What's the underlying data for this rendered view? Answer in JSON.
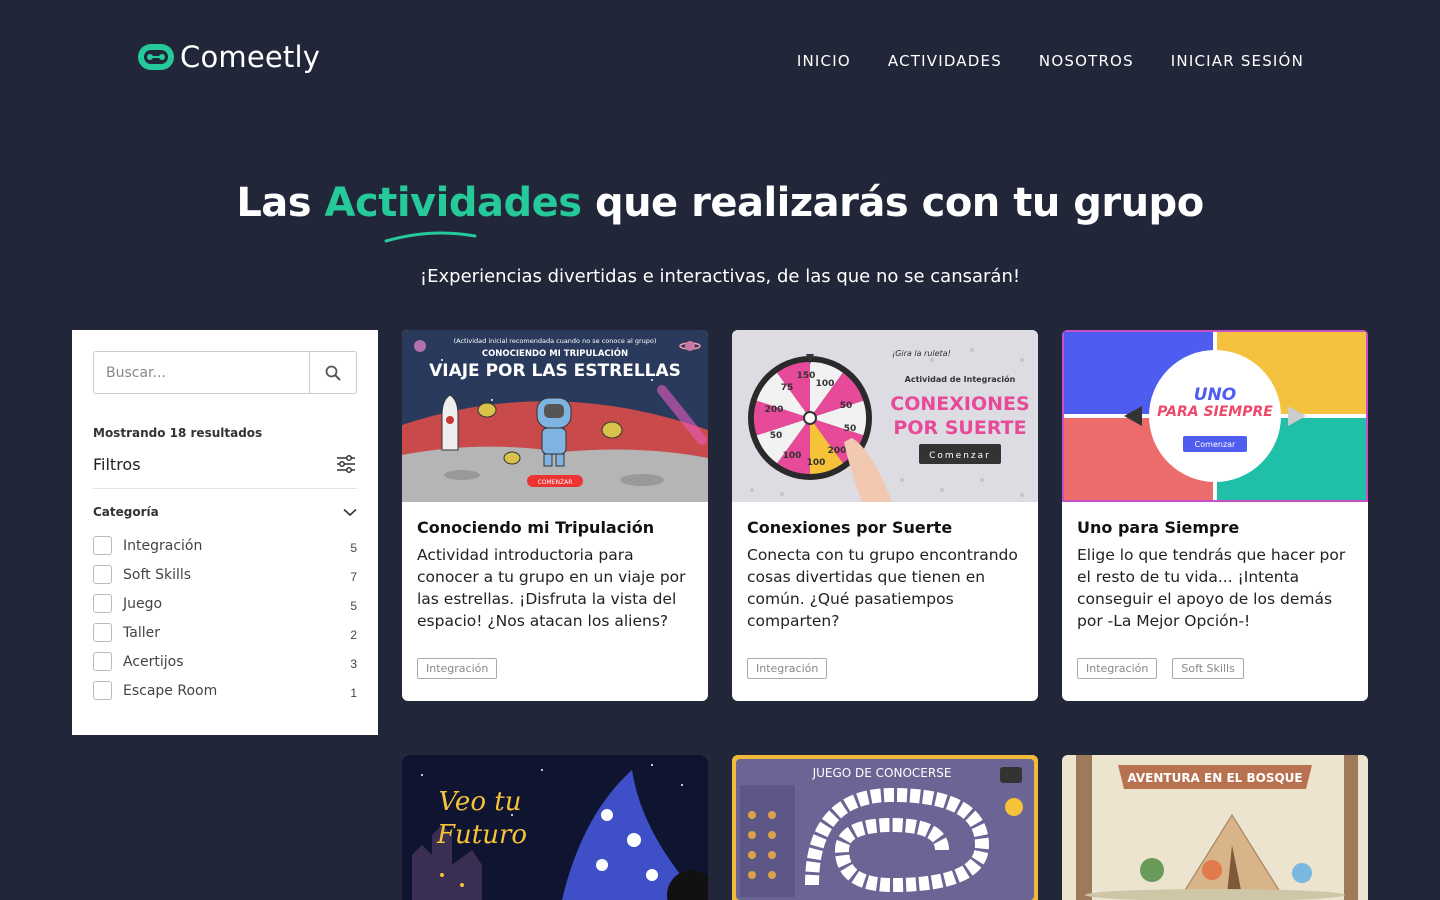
{
  "header": {
    "logo_text": "Comeetly",
    "nav": [
      "INICIO",
      "ACTIVIDADES",
      "NOSOTROS",
      "INICIAR SESIÓN"
    ]
  },
  "hero": {
    "title_before": "Las ",
    "title_accent": "Actividades",
    "title_after": " que realizarás con tu grupo",
    "subtitle": "¡Experiencias divertidas e interactivas, de las que no se cansarán!"
  },
  "sidebar": {
    "search_placeholder": "Buscar...",
    "results_text": "Mostrando 18 resultados",
    "filters_title": "Filtros",
    "category_title": "Categoría",
    "categories": [
      {
        "label": "Integración",
        "count": "5"
      },
      {
        "label": "Soft Skills",
        "count": "7"
      },
      {
        "label": "Juego",
        "count": "5"
      },
      {
        "label": "Taller",
        "count": "2"
      },
      {
        "label": "Acertijos",
        "count": "3"
      },
      {
        "label": "Escape Room",
        "count": "1"
      }
    ]
  },
  "cards": [
    {
      "title": "Conociendo mi Tripulación",
      "desc": "Actividad introductoria para conocer a tu grupo en un viaje por las estrellas. ¡Disfruta la vista del espacio! ¿Nos atacan los aliens?",
      "tags": [
        "Integración"
      ],
      "img": {
        "note": "(Actividad inicial recomendada cuando no se conoce al grupo)",
        "kicker": "CONOCIENDO MI TRIPULACIÓN",
        "headline": "VIAJE POR LAS ESTRELLAS",
        "button": "COMENZAR"
      }
    },
    {
      "title": "Conexiones por Suerte",
      "desc": "Conecta con tu grupo encontrando cosas divertidas que tienen en común. ¿Qué pasatiempos comparten?",
      "tags": [
        "Integración"
      ],
      "img": {
        "kicker": "Actividad de Integración",
        "headline1": "CONEXIONES",
        "headline2": "POR SUERTE",
        "button": "Comenzar",
        "spin": "¡Gira la ruleta!",
        "wheel_values": [
          "100",
          "50",
          "50",
          "200",
          "100",
          "100",
          "50",
          "200",
          "75",
          "150"
        ]
      }
    },
    {
      "title": "Uno para Siempre",
      "desc": "Elige lo que tendrás que hacer por el resto de tu vida... ¡Intenta conseguir el apoyo de los demás por -La Mejor Opción-!",
      "tags": [
        "Integración",
        "Soft Skills"
      ],
      "img": {
        "headline1": "UNO",
        "headline2": "PARA SIEMPRE",
        "button": "Comenzar"
      }
    }
  ],
  "lower_cards": [
    {
      "img_title1": "Veo tu",
      "img_title2": "Futuro"
    },
    {
      "img_title": "JUEGO DE CONOCERSE"
    },
    {
      "img_title": "AVENTURA EN EL BOSQUE"
    }
  ],
  "colors": {
    "background": "#212638",
    "accent": "#26c99a"
  }
}
